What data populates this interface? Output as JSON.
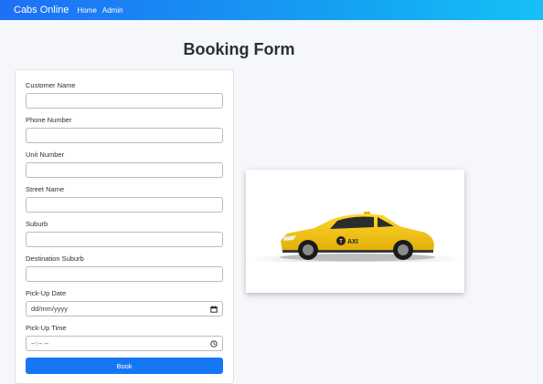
{
  "nav": {
    "brand": "Cabs Online",
    "links": [
      "Home",
      "Admin"
    ]
  },
  "page": {
    "title": "Booking Form"
  },
  "form": {
    "fields": [
      {
        "label": "Customer Name",
        "value": ""
      },
      {
        "label": "Phone Number",
        "value": ""
      },
      {
        "label": "Unit Number",
        "value": ""
      },
      {
        "label": "Street Name",
        "value": ""
      },
      {
        "label": "Suburb",
        "value": ""
      },
      {
        "label": "Destination Suburb",
        "value": ""
      },
      {
        "label": "Pick-Up Date",
        "value": "dd/mm/yyyy",
        "icon": "calendar-icon"
      },
      {
        "label": "Pick-Up Time",
        "value": "--:-- --",
        "icon": "clock-icon"
      }
    ],
    "submit_label": "Book"
  },
  "image": {
    "subject": "yellow taxi car",
    "sign_text": "TAXI"
  },
  "colors": {
    "nav_start": "#1e6ff5",
    "nav_end": "#16c0f7",
    "button": "#1677f5",
    "taxi": "#f2c418"
  }
}
